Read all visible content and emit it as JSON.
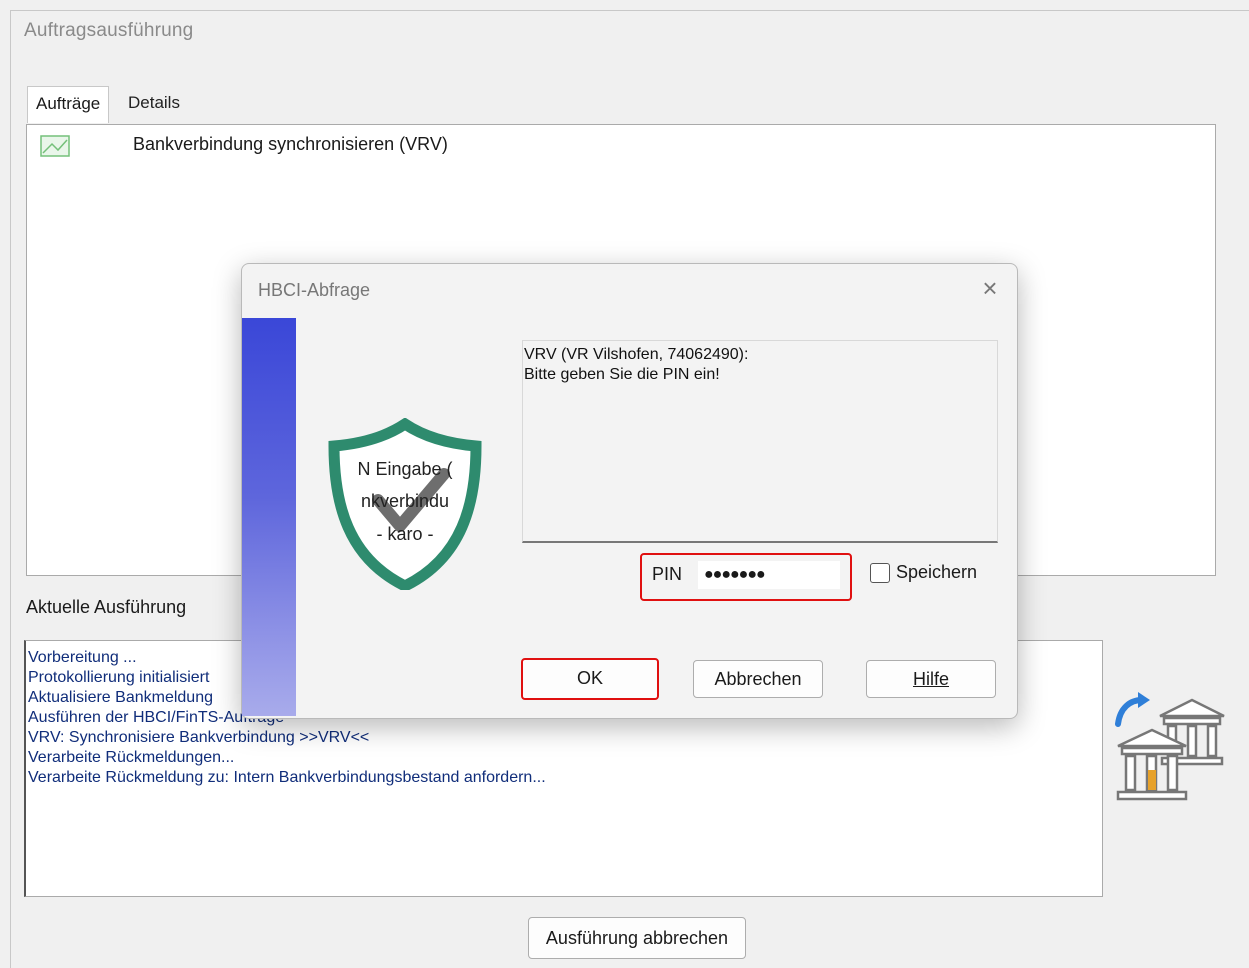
{
  "window": {
    "title": "Auftragsausführung"
  },
  "tabs": [
    {
      "label": "Aufträge",
      "active": true
    },
    {
      "label": "Details",
      "active": false
    }
  ],
  "jobs": [
    {
      "icon": "image-placeholder-icon",
      "label": "Bankverbindung synchronisieren (VRV)"
    }
  ],
  "current_execution": {
    "label": "Aktuelle Ausführung",
    "log": [
      "Vorbereitung ...",
      "Protokollierung initialisiert",
      "Aktualisiere Bankmeldung",
      "Ausführen der HBCI/FinTS-Aufträge",
      "VRV: Synchronisiere Bankverbindung >>VRV<<",
      "Verarbeite Rückmeldungen...",
      "Verarbeite Rückmeldung zu: Intern Bankverbindungsbestand anfordern..."
    ]
  },
  "abort_button": "Ausführung abbrechen",
  "dialog": {
    "title": "HBCI-Abfrage",
    "shield_lines": [
      "N Eingabe (",
      "nkverbindu",
      "- karo -"
    ],
    "message_line1": "VRV (VR Vilshofen, 74062490):",
    "message_line2": " Bitte geben Sie die PIN ein!",
    "pin_label": "PIN",
    "pin_value": "●●●●●●●",
    "save_label": "Speichern",
    "ok_label": "OK",
    "cancel_label": "Abbrechen",
    "help_label": "Hilfe"
  },
  "colors": {
    "highlight": "#e01010",
    "stripe": "#3a47d8",
    "shield": "#2e8b6e",
    "log_text": "#102d7a"
  }
}
